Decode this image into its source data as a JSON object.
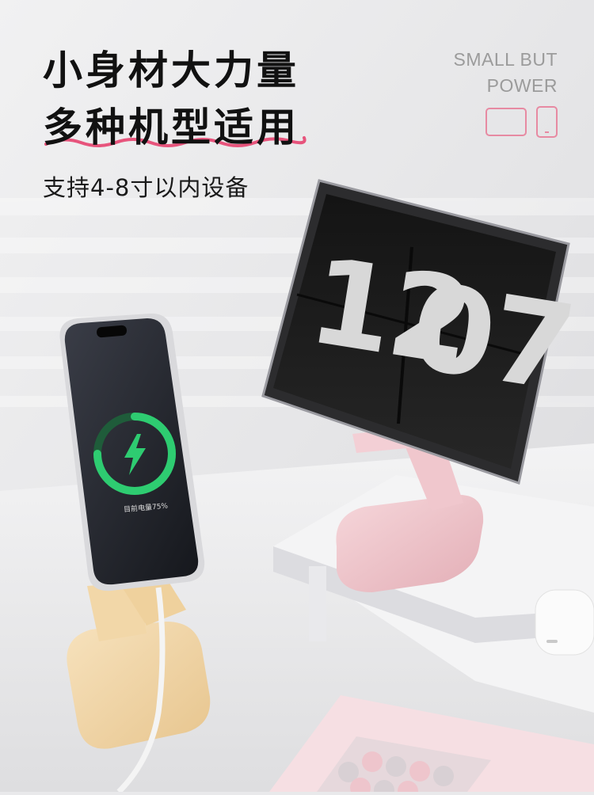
{
  "headline": {
    "line1": "小身材大力量",
    "line2": "多种机型适用"
  },
  "subtitle": "支持4-8寸以内设备",
  "tagline": {
    "line1": "SMALL BUT",
    "line2": "POWER"
  },
  "icons": [
    "tablet-icon",
    "phone-icon"
  ],
  "tablet_clock": {
    "hours": "12",
    "minutes": "07"
  },
  "phone_screen": {
    "charging_status": "目前电量75%",
    "charge_level": 0.75,
    "icon": "lightning-bolt-icon"
  },
  "colors": {
    "accent_underline": "#e7547c",
    "pink_stand": "#eec6cc",
    "yellow_stand": "#f0d6a8",
    "charge_ring": "#2ecc71"
  }
}
